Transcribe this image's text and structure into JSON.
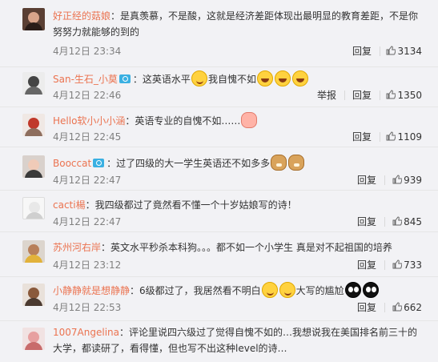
{
  "actions": {
    "reply_label": "回复",
    "report_label": "举报"
  },
  "colors": {
    "username": "#eb7350",
    "vip_badge": "#3ab0e2",
    "time": "#808080"
  },
  "comments": [
    {
      "user": "好正经的菇娘",
      "text": "：是真羡慕，不是酸，这就是经济差距体现出最明显的教育差距，不是你努努力就能够的到的",
      "time": "4月12日 23:34",
      "likes": "3134",
      "emoji": []
    },
    {
      "user": "San-生石_小莫",
      "text_before": "：这英语水平",
      "text_after": "我自愧不如",
      "time": "4月12日 22:46",
      "likes": "1350",
      "emoji": [
        "sly-face-emoji",
        "laugh-cry-emoji",
        "laugh-cry-emoji",
        "laugh-cry-emoji"
      ]
    },
    {
      "user": "Hello软小小小涵",
      "text": "：英语专业的自愧不如……",
      "time": "4月12日 22:45",
      "likes": "1109",
      "emoji": [
        "pink-shy-emoji"
      ]
    },
    {
      "user": "Booccat",
      "text": "：过了四级的大一学生英语还不如多多",
      "time": "4月12日 22:47",
      "likes": "939",
      "emoji": [
        "doge-emoji",
        "doge-emoji"
      ]
    },
    {
      "user": "cacti楊",
      "text": "：我四级都过了竟然看不懂一个十岁姑娘写的诗！",
      "time": "4月12日 22:47",
      "likes": "845",
      "emoji": []
    },
    {
      "user": "苏州河右岸",
      "text": "：英文水平秒杀本科狗。。。都不如一个小学生 真是对不起祖国的培养",
      "time": "4月12日 23:12",
      "likes": "733",
      "emoji": []
    },
    {
      "user": "小静静就是想静静",
      "text_before": "：6级都过了，我居然看不明白",
      "text_after": "大写的尴尬",
      "time": "4月12日 22:53",
      "likes": "662",
      "emoji": [
        "sly-face-emoji",
        "sly-face-emoji",
        "black-face-emoji",
        "black-face-emoji"
      ]
    },
    {
      "user": "1007Angelina",
      "text": "：评论里说四六级过了觉得自愧不如的…我想说我在美国排名前三十的大学，都读研了，看得懂，但也写不出这种level的诗…",
      "time": "",
      "likes": "",
      "emoji": []
    }
  ]
}
